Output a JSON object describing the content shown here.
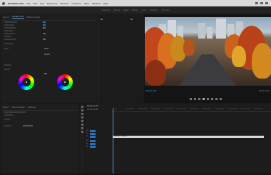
{
  "menubar": {
    "items": [
      {
        "label": "Premiere Pro",
        "bold": true
      },
      {
        "label": "File"
      },
      {
        "label": "Edit"
      },
      {
        "label": "Clip"
      },
      {
        "label": "Sequence"
      },
      {
        "label": "Markers"
      },
      {
        "label": "Graphics"
      },
      {
        "label": "View"
      },
      {
        "label": "Window"
      },
      {
        "label": "Help"
      }
    ]
  },
  "workspaces": [
    "Assembly",
    "Editing",
    "Color",
    "Effects",
    "Audio",
    "Graphics",
    "Libraries"
  ],
  "workspace_active": "Color",
  "left_panel": {
    "tabs": [
      "Source",
      "Lumetri Color",
      "Effect Controls"
    ],
    "active_tab": "Lumetri Color"
  },
  "program": {
    "timecode": "00:00:12:08",
    "duration": "00:00:30:00"
  },
  "project": {
    "tabs": [
      "Project",
      "Media Browser",
      "Libraries"
    ]
  },
  "timeline": {
    "sequence_name": "Sequence 01",
    "timecode": "00:00:12:08",
    "ruler": [
      "00:00",
      "00:00:05:00",
      "00:00:10:00",
      "00:00:15:00",
      "00:00:20:00",
      "00:00:25:00",
      "00:00:30:00",
      "00:00:35:00",
      "00:00:40:00",
      "00:00:45:00",
      "00:00:50:00",
      "00:00:55:00"
    ],
    "tracks": [
      "V3",
      "V2",
      "V1",
      "A1",
      "A2",
      "A3"
    ],
    "clip_label": "Autumn_City.mp4"
  },
  "accent_color": "#4aa0e6"
}
